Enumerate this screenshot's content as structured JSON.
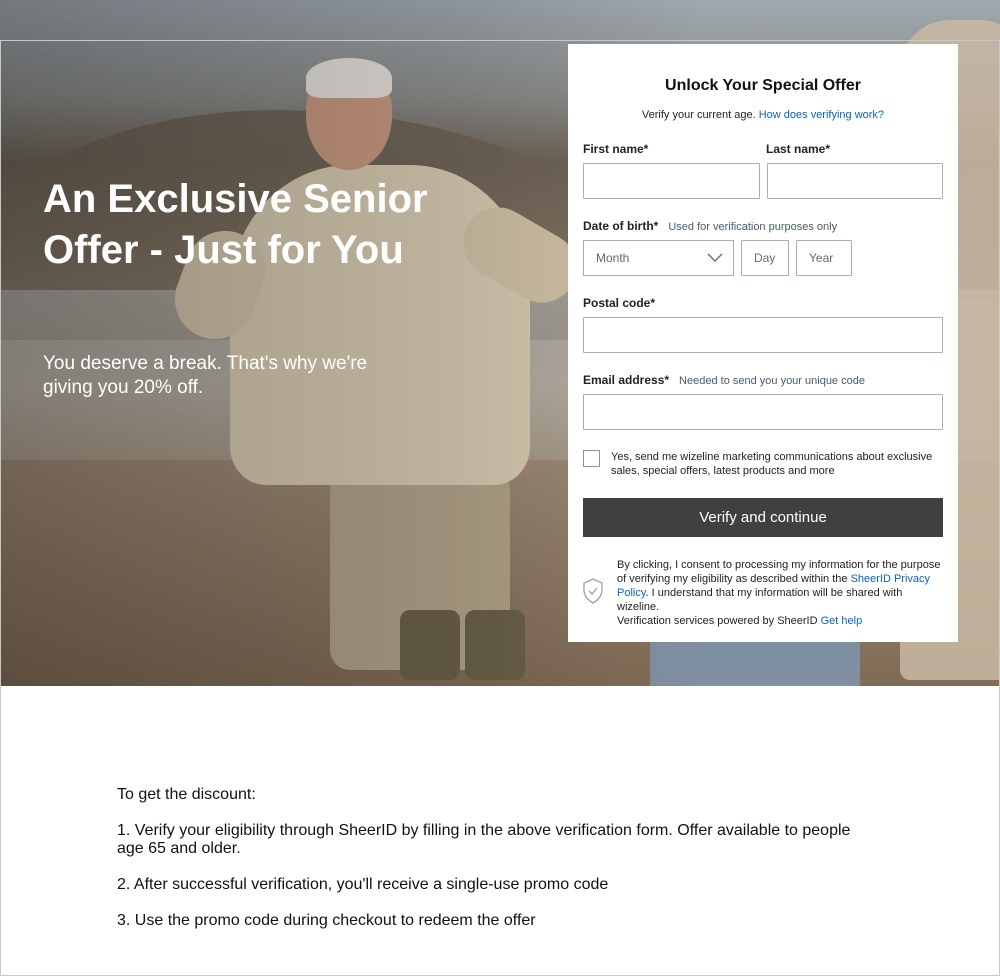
{
  "hero": {
    "title": "An Exclusive Senior Offer - Just for You",
    "subtitle": "You deserve a break. That's why we're giving you 20% off."
  },
  "form": {
    "title": "Unlock Your Special Offer",
    "intro_text": "Verify your current age.",
    "intro_link": "How does verifying work?",
    "first_name_label": "First name*",
    "last_name_label": "Last name*",
    "dob_label": "Date of birth*",
    "dob_hint": "Used for verification purposes only",
    "month_placeholder": "Month",
    "day_placeholder": "Day",
    "year_placeholder": "Year",
    "postal_label": "Postal code*",
    "email_label": "Email address*",
    "email_hint": "Needed to send you your unique code",
    "marketing_optin": "Yes, send me wizeline marketing communications about exclusive sales, special offers, latest products and more",
    "submit_label": "Verify and continue",
    "legal_before_link": "By clicking, I consent to processing my information for the purpose of verifying my eligibility as described within the",
    "legal_link": "SheerID Privacy Policy",
    "legal_after_link": ". I understand that my information will be shared with wizeline.",
    "powered_by": "Verification services powered by SheerID",
    "help_link": "Get help"
  },
  "instructions": {
    "heading": "To get the discount:",
    "steps": [
      "1. Verify your eligibility through SheerID by filling in the above verification form. Offer available to people age 65 and older.",
      "2. After successful verification, you'll receive a single-use promo code",
      "3. Use the promo code during checkout to redeem the offer"
    ]
  },
  "colors": {
    "button_bg": "#404040",
    "link": "#0b62c2",
    "input_border": "#a8aeb6"
  }
}
